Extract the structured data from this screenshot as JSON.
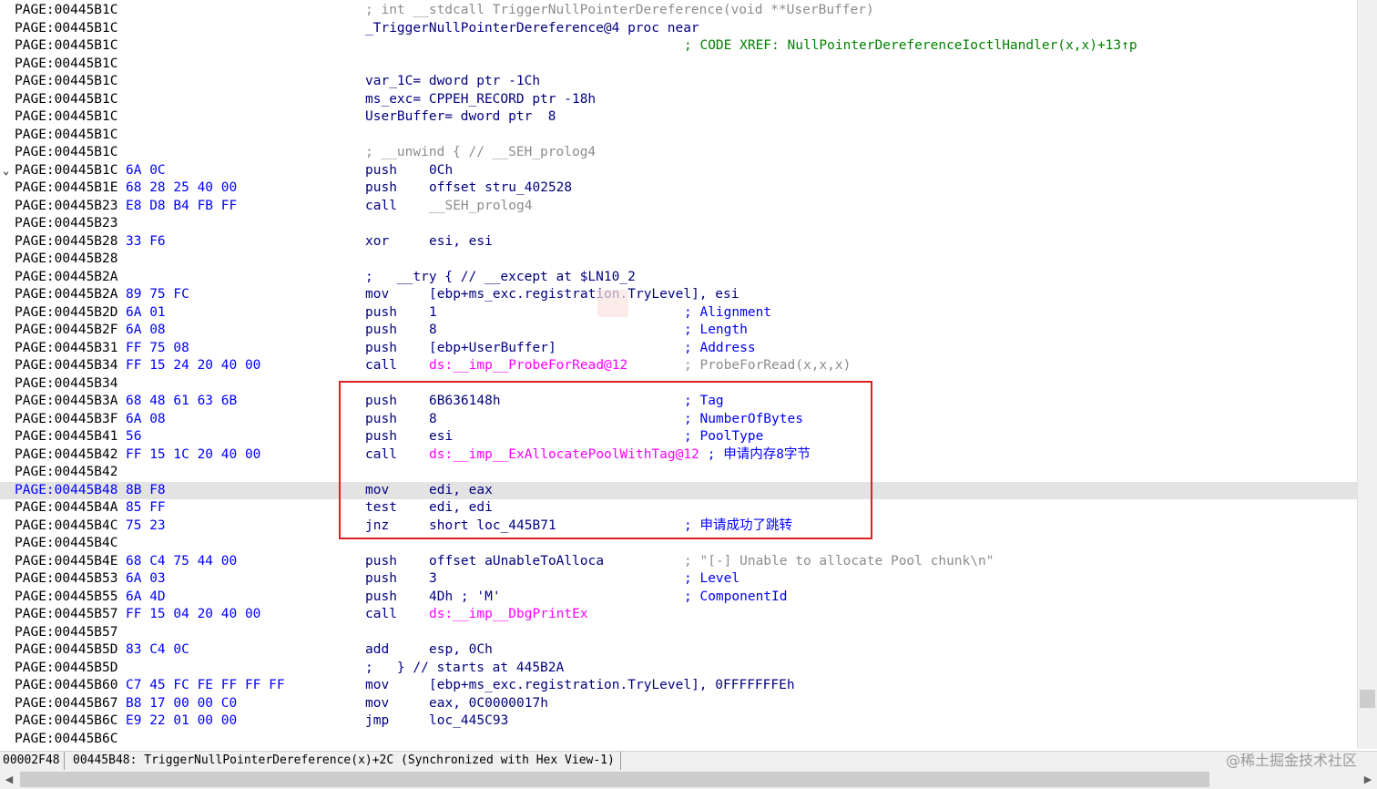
{
  "lines": [
    {
      "addr": "PAGE:00445B1C",
      "bytes": "",
      "c3": "; int __stdcall TriggerNullPointerDereference(void **UserBuffer)",
      "c3class": "comment"
    },
    {
      "addr": "PAGE:00445B1C",
      "bytes": "",
      "c3": "_TriggerNullPointerDereference@4 proc near",
      "c3class": "name"
    },
    {
      "addr": "PAGE:00445B1C",
      "bytes": "",
      "c3": "",
      "cm": "; CODE XREF: NullPointerDereferenceIoctlHandler(x,x)+13↑p",
      "cmclass": "num"
    },
    {
      "addr": "PAGE:00445B1C",
      "bytes": "",
      "c3": ""
    },
    {
      "addr": "PAGE:00445B1C",
      "bytes": "",
      "c3": "var_1C= dword ptr -1Ch",
      "c3class": "name"
    },
    {
      "addr": "PAGE:00445B1C",
      "bytes": "",
      "c3": "ms_exc= CPPEH_RECORD ptr -18h",
      "c3class": "name"
    },
    {
      "addr": "PAGE:00445B1C",
      "bytes": "",
      "c3": "UserBuffer= dword ptr  8",
      "c3class": "name"
    },
    {
      "addr": "PAGE:00445B1C",
      "bytes": "",
      "c3": ""
    },
    {
      "addr": "PAGE:00445B1C",
      "bytes": "",
      "c3": "; __unwind { // __SEH_prolog4",
      "c3class": "comment"
    },
    {
      "addr": "PAGE:00445B1C",
      "bytes": "6A 0C",
      "mn": "push",
      "op": "0Ch",
      "fold": true
    },
    {
      "addr": "PAGE:00445B1E",
      "bytes": "68 28 25 40 00",
      "mn": "push",
      "op": "offset stru_402528"
    },
    {
      "addr": "PAGE:00445B23",
      "bytes": "E8 D8 B4 FB FF",
      "mn": "call",
      "op": "__SEH_prolog4",
      "opclass": "comment"
    },
    {
      "addr": "PAGE:00445B23",
      "bytes": "",
      "c3": ""
    },
    {
      "addr": "PAGE:00445B28",
      "bytes": "33 F6",
      "mn": "xor",
      "op": "esi, esi"
    },
    {
      "addr": "PAGE:00445B28",
      "bytes": "",
      "c3": ""
    },
    {
      "addr": "PAGE:00445B2A",
      "bytes": "",
      "c3": ";   __try { // __except at $LN10_2",
      "c3class": "name"
    },
    {
      "addr": "PAGE:00445B2A",
      "bytes": "89 75 FC",
      "mn": "mov",
      "op": "[ebp+ms_exc.registration.TryLevel], esi"
    },
    {
      "addr": "PAGE:00445B2D",
      "bytes": "6A 01",
      "mn": "push",
      "op": "1",
      "cm": "; Alignment"
    },
    {
      "addr": "PAGE:00445B2F",
      "bytes": "6A 08",
      "mn": "push",
      "op": "8",
      "cm": "; Length"
    },
    {
      "addr": "PAGE:00445B31",
      "bytes": "FF 75 08",
      "mn": "push",
      "op": "[ebp+UserBuffer]",
      "cm": "; Address"
    },
    {
      "addr": "PAGE:00445B34",
      "bytes": "FF 15 24 20 40 00",
      "mn": "call",
      "op": "ds:__imp__ProbeForRead@12",
      "opclass": "imp",
      "cm": "; ProbeForRead(x,x,x)",
      "cmclass": "gray"
    },
    {
      "addr": "PAGE:00445B34",
      "bytes": "",
      "c3": ""
    },
    {
      "addr": "PAGE:00445B3A",
      "bytes": "68 48 61 63 6B",
      "mn": "push",
      "op": "6B636148h",
      "cm": "; Tag"
    },
    {
      "addr": "PAGE:00445B3F",
      "bytes": "6A 08",
      "mn": "push",
      "op": "8",
      "cm": "; NumberOfBytes"
    },
    {
      "addr": "PAGE:00445B41",
      "bytes": "56",
      "mn": "push",
      "op": "esi",
      "cm": "; PoolType"
    },
    {
      "addr": "PAGE:00445B42",
      "bytes": "FF 15 1C 20 40 00",
      "mn": "call",
      "op": "ds:__imp__ExAllocatePoolWithTag@12",
      "opclass": "imp",
      "cm": " ; 申请内存8字节",
      "cmoff": 1
    },
    {
      "addr": "PAGE:00445B42",
      "bytes": "",
      "c3": ""
    },
    {
      "addr": "PAGE:00445B48",
      "bytes": "8B F8",
      "mn": "mov",
      "op": "edi, eax",
      "hl": true
    },
    {
      "addr": "PAGE:00445B4A",
      "bytes": "85 FF",
      "mn": "test",
      "op": "edi, edi"
    },
    {
      "addr": "PAGE:00445B4C",
      "bytes": "75 23",
      "mn": "jnz",
      "op": "short loc_445B71",
      "cm": "; 申请成功了跳转"
    },
    {
      "addr": "PAGE:00445B4C",
      "bytes": "",
      "c3": ""
    },
    {
      "addr": "PAGE:00445B4E",
      "bytes": "68 C4 75 44 00",
      "mn": "push",
      "op": "offset aUnableToAlloca",
      "cm": "; \"[-] Unable to allocate Pool chunk\\n\"",
      "cmclass": "gray"
    },
    {
      "addr": "PAGE:00445B53",
      "bytes": "6A 03",
      "mn": "push",
      "op": "3",
      "cm": "; Level"
    },
    {
      "addr": "PAGE:00445B55",
      "bytes": "6A 4D",
      "mn": "push",
      "op": "4Dh ; 'M'",
      "cm": "; ComponentId"
    },
    {
      "addr": "PAGE:00445B57",
      "bytes": "FF 15 04 20 40 00",
      "mn": "call",
      "op": "ds:__imp__DbgPrintEx",
      "opclass": "imp"
    },
    {
      "addr": "PAGE:00445B57",
      "bytes": "",
      "c3": ""
    },
    {
      "addr": "PAGE:00445B5D",
      "bytes": "83 C4 0C",
      "mn": "add",
      "op": "esp, 0Ch"
    },
    {
      "addr": "PAGE:00445B5D",
      "bytes": "",
      "c3": ";   } // starts at 445B2A",
      "c3class": "name"
    },
    {
      "addr": "PAGE:00445B60",
      "bytes": "C7 45 FC FE FF FF FF",
      "mn": "mov",
      "op": "[ebp+ms_exc.registration.TryLevel], 0FFFFFFFEh"
    },
    {
      "addr": "PAGE:00445B67",
      "bytes": "B8 17 00 00 C0",
      "mn": "mov",
      "op": "eax, 0C0000017h"
    },
    {
      "addr": "PAGE:00445B6C",
      "bytes": "E9 22 01 00 00",
      "mn": "jmp",
      "op": "loc_445C93"
    },
    {
      "addr": "PAGE:00445B6C",
      "bytes": "",
      "c3": ""
    }
  ],
  "status": {
    "offset": "00002F48",
    "location": "00445B48: TriggerNullPointerDereference(x)+2C (Synchronized with Hex View-1)",
    "watermark": "@稀土掘金技术社区"
  },
  "scroll": {
    "left_arrow": "◀",
    "right_arrow": "▶"
  }
}
